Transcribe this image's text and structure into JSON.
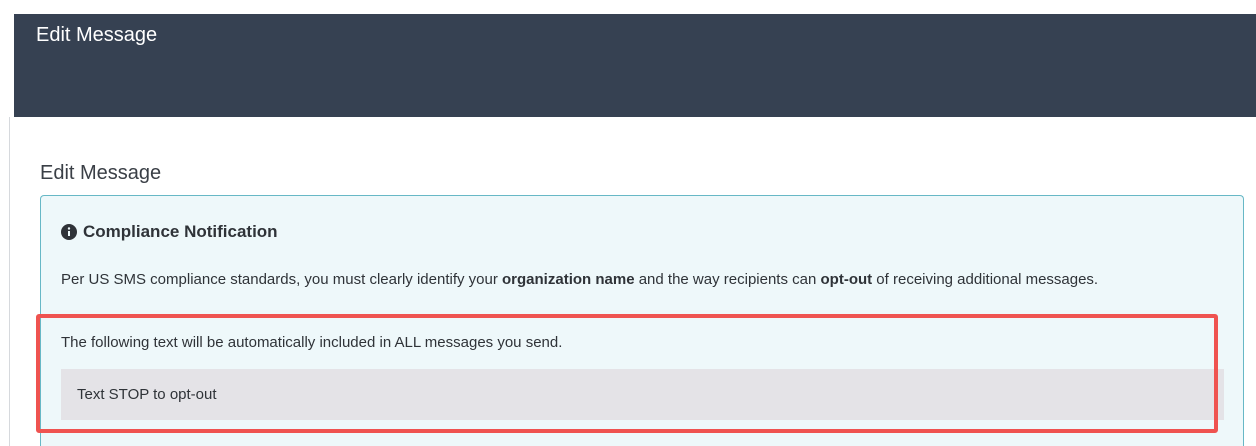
{
  "header": {
    "title": "Edit Message"
  },
  "section": {
    "title": "Edit Message"
  },
  "notification": {
    "icon": "info-circle-icon",
    "heading": "Compliance Notification",
    "body_prefix": "Per US SMS compliance standards, you must clearly identify your ",
    "body_bold_1": "organization name",
    "body_middle": " and the way recipients can ",
    "body_bold_2": "opt-out",
    "body_suffix": " of receiving additional messages.",
    "included_notice": "The following text will be automatically included in ALL messages you send.",
    "optout_text": "Text STOP to opt-out"
  },
  "colors": {
    "header_bg": "#364152",
    "notice_bg": "#eef8fa",
    "notice_border": "#67b8c6",
    "optout_bg": "#e4e3e7",
    "highlight": "#ef5350"
  }
}
